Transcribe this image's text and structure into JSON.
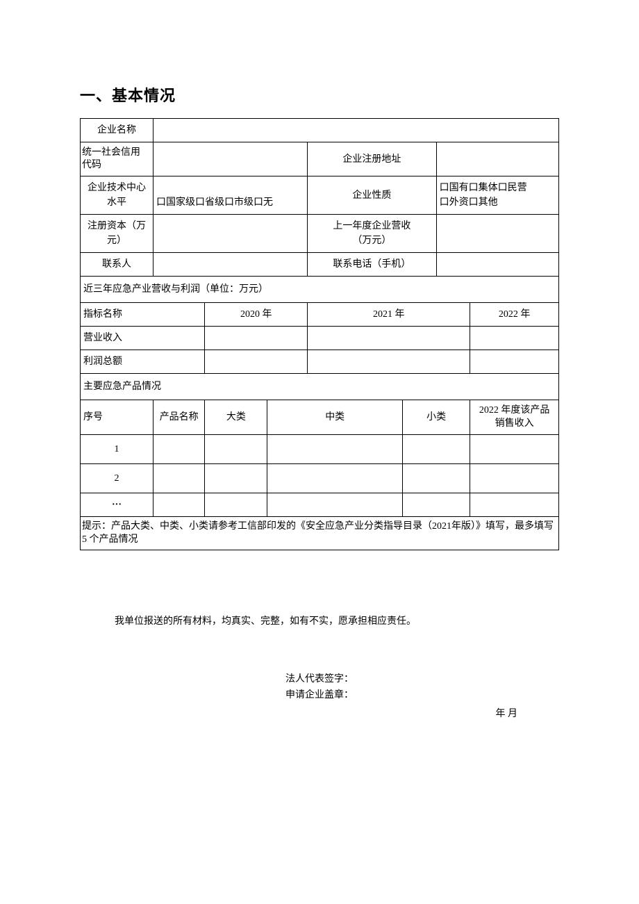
{
  "heading": "一、基本情况",
  "labels": {
    "company_name": "企业名称",
    "usci": "统一社会信用代码",
    "reg_addr": "企业注册地址",
    "tech_center_l1": "企业技术中心",
    "tech_center_l2": "水平",
    "nature": "企业性质",
    "reg_capital_l1": "注册资本（万",
    "reg_capital_l2": "元）",
    "prev_revenue_l1": "上一年度企业营收",
    "prev_revenue_l2": "（万元）",
    "contact": "联系人",
    "contact_phone": "联系电话（手机）",
    "three_year_header": "近三年应急产业营收与利润（单位：万元）",
    "indicator": "指标名称",
    "y2020": "2020 年",
    "y2021": "2021 年",
    "y2022": "2022 年",
    "operating_income": "营业收入",
    "total_profit": "利润总额",
    "product_section": "主要应急产品情况",
    "seq": "序号",
    "product_name": "产品名称",
    "cat_large": "大类",
    "cat_mid": "中类",
    "cat_small": "小类",
    "sales_2022_l1": "2022 年度该产品",
    "sales_2022_l2": "销售收入",
    "row1": "1",
    "row2": "2",
    "row3": "···",
    "tip": "提示：产品大类、中类、小类请参考工信部印发的《安全应急产业分类指导目录（2021年版）》填写，最多填写 5 个产品情况"
  },
  "tech_center_checkboxes": "口国家级口省级口市级口无",
  "nature_checkboxes_l1": "口国有口集体口民营",
  "nature_checkboxes_l2": "口外资口其他",
  "values": {
    "company_name": "",
    "usci": "",
    "reg_addr": "",
    "reg_capital": "",
    "prev_revenue": "",
    "contact": "",
    "contact_phone": "",
    "income_2020": "",
    "income_2021": "",
    "income_2022": "",
    "profit_2020": "",
    "profit_2021": "",
    "profit_2022": ""
  },
  "declaration": "我单位报送的所有材料，均真实、完整，如有不实，愿承担相应责任。",
  "sign": {
    "legal_rep": "法人代表签字：",
    "stamp": "申请企业盖章：",
    "date": "年 月"
  }
}
